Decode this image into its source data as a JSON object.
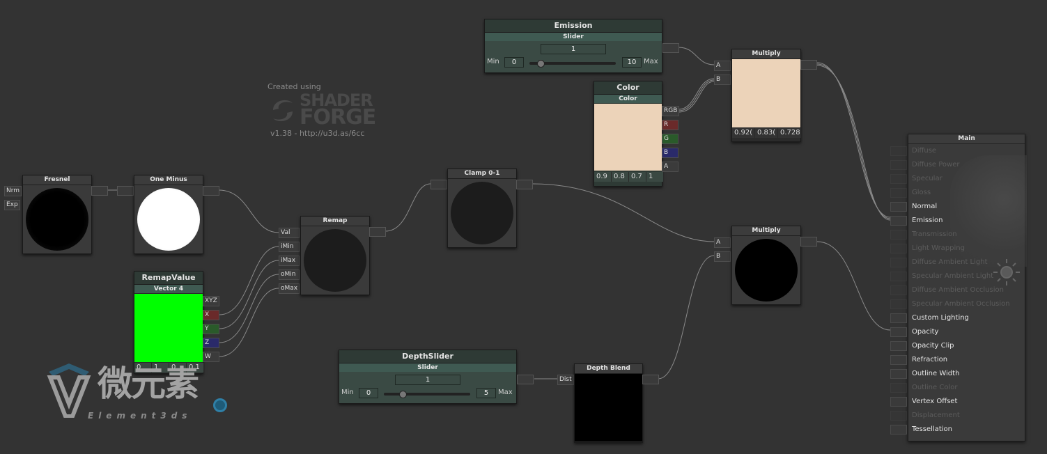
{
  "logo": {
    "created_using": "Created using",
    "brand_top": "SHADER",
    "brand_bottom": "FORGE",
    "version": "v1.38 - http://u3d.as/6cc"
  },
  "watermark": {
    "cn": "微元素",
    "en": "Element3ds"
  },
  "colors": {
    "canvas": "#333333",
    "slider_green": "#3f5a52",
    "color_swatch": "#ecd3b9",
    "vector_green": "#00ff00"
  },
  "nodes": {
    "fresnel": {
      "title": "Fresnel",
      "in1": "Nrm",
      "in2": "Exp"
    },
    "one_minus": {
      "title": "One Minus"
    },
    "remap_value": {
      "title": "RemapValue",
      "subtitle": "Vector 4",
      "outs": [
        "XYZ",
        "X",
        "Y",
        "Z",
        "W"
      ],
      "values": [
        "0",
        "1",
        "0",
        "0.1"
      ]
    },
    "remap": {
      "title": "Remap",
      "ins": [
        "Val",
        "iMin",
        "iMax",
        "oMin",
        "oMax"
      ]
    },
    "clamp": {
      "title": "Clamp 0-1"
    },
    "emission": {
      "title": "Emission",
      "subtitle": "Slider",
      "value": "1",
      "min_label": "Min",
      "min": "0",
      "max": "10",
      "max_label": "Max",
      "knob_fraction": 0.1
    },
    "color": {
      "title": "Color",
      "subtitle": "Color",
      "outs": [
        "RGB",
        "R",
        "G",
        "B",
        "A"
      ],
      "values": [
        "0.9",
        "0.8",
        "0.7",
        "1"
      ]
    },
    "multiply1": {
      "title": "Multiply",
      "ins": [
        "A",
        "B"
      ],
      "values": [
        "0.92(",
        "0.83(",
        "0.728"
      ]
    },
    "multiply2": {
      "title": "Multiply",
      "ins": [
        "A",
        "B"
      ]
    },
    "depth_slider": {
      "title": "DepthSlider",
      "subtitle": "Slider",
      "value": "1",
      "min_label": "Min",
      "min": "0",
      "max": "5",
      "max_label": "Max",
      "knob_fraction": 0.2
    },
    "depth_blend": {
      "title": "Depth Blend",
      "in1": "Dist"
    }
  },
  "main": {
    "title": "Main",
    "inputs": [
      {
        "label": "Diffuse",
        "active": false
      },
      {
        "label": "Diffuse Power",
        "active": false
      },
      {
        "label": "Specular",
        "active": false
      },
      {
        "label": "Gloss",
        "active": false
      },
      {
        "label": "Normal",
        "active": true
      },
      {
        "label": "Emission",
        "active": true
      },
      {
        "label": "Transmission",
        "active": false
      },
      {
        "label": "Light Wrapping",
        "active": false
      },
      {
        "label": "Diffuse Ambient Light",
        "active": false
      },
      {
        "label": "Specular Ambient Light",
        "active": false
      },
      {
        "label": "Diffuse Ambient Occlusion",
        "active": false
      },
      {
        "label": "Specular Ambient Occlusion",
        "active": false
      },
      {
        "label": "Custom Lighting",
        "active": true
      },
      {
        "label": "Opacity",
        "active": true
      },
      {
        "label": "Opacity Clip",
        "active": true
      },
      {
        "label": "Refraction",
        "active": true
      },
      {
        "label": "Outline Width",
        "active": true
      },
      {
        "label": "Outline Color",
        "active": false
      },
      {
        "label": "Vertex Offset",
        "active": true
      },
      {
        "label": "Displacement",
        "active": false
      },
      {
        "label": "Tessellation",
        "active": true
      }
    ]
  }
}
